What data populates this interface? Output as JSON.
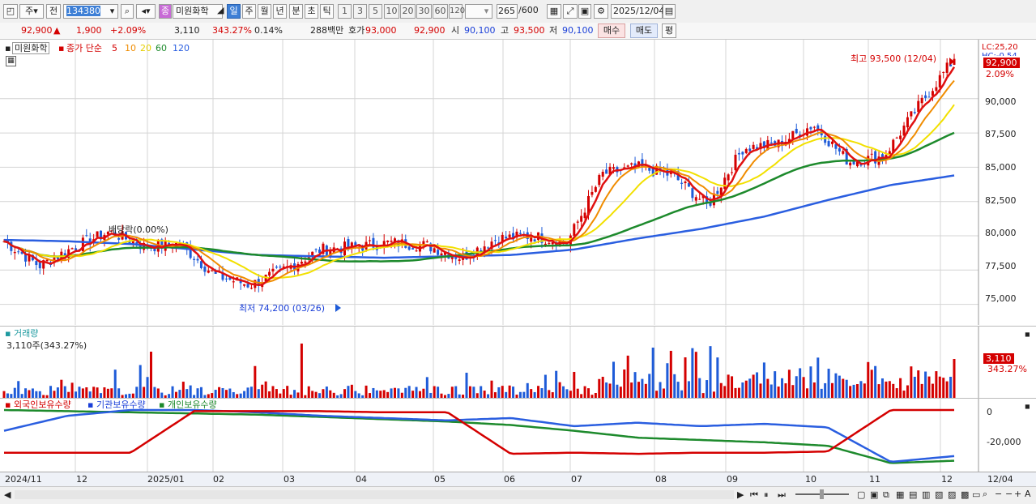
{
  "toolbar": {
    "type_select": "주",
    "prev_label": "전",
    "code": "134380",
    "name": "미원화학",
    "periods": [
      "일",
      "주",
      "월",
      "년",
      "분",
      "초",
      "틱"
    ],
    "active_period": "일",
    "numbers": [
      "1",
      "3",
      "5",
      "10",
      "20",
      "30",
      "60",
      "120"
    ],
    "count": "265",
    "count_total": "/600",
    "date": "2025/12/04"
  },
  "info": {
    "price": "92,900",
    "change": "1,900",
    "rate": "+2.09%",
    "volume": "3,110",
    "vol_rate": "343.27%",
    "turnover": "0.14%",
    "amount": "288백만",
    "quote_label": "호가",
    "bid": "93,000",
    "ask": "92,900",
    "open_label": "시",
    "open": "90,100",
    "high_label": "고",
    "high": "93,500",
    "low_label": "저",
    "low": "90,100",
    "buy_label": "매수",
    "sell_label": "매도",
    "avg_label": "평"
  },
  "price_panel": {
    "stock_name": "미원화학",
    "ma_label": "종가 단순",
    "ma_periods": [
      "5",
      "10",
      "20",
      "60",
      "120"
    ],
    "dividend_label": "배당락(0.00%)",
    "high_marker": "최고 93,500 (12/04)",
    "low_marker": "최저 74,200 (03/26)",
    "lc": "LC:25,20",
    "hc": "HC:-0.54",
    "last_price": "92,900",
    "last_rate": "2.09%",
    "y_ticks": [
      "90,000",
      "87,500",
      "85,000",
      "82,500",
      "80,000",
      "77,500",
      "75,000"
    ]
  },
  "volume_panel": {
    "title": "거래량",
    "value": "3,110주(343.27%)",
    "last_value": "3,110",
    "last_rate": "343.27%"
  },
  "holding_panel": {
    "foreign_label": "외국인보유수량",
    "inst_label": "기관보유수량",
    "indiv_label": "개인보유수량",
    "y_ticks": [
      "0",
      "-20,000"
    ]
  },
  "x_labels": [
    "2024/11",
    "12",
    "2025/01",
    "02",
    "03",
    "04",
    "05",
    "06",
    "07",
    "08",
    "09",
    "10",
    "11",
    "12",
    "12/04"
  ],
  "colors": {
    "up": "#d40000",
    "down": "#1e5bd8",
    "ma5": "#e01010",
    "ma10": "#f08c00",
    "ma20": "#f2e000",
    "ma60": "#1d8a2c",
    "ma120": "#2a5ee0",
    "grid": "#d4d4d4"
  },
  "chart_data": {
    "type": "candlestick",
    "y_range": [
      73500,
      94300
    ],
    "price_keypoints": [
      {
        "date": "2024/11",
        "close": 79600
      },
      {
        "date": "2024/11 mid",
        "close": 77800
      },
      {
        "date": "2024/12",
        "close": 79200
      },
      {
        "date": "2024/12 mid",
        "close": 80300
      },
      {
        "date": "2025/01",
        "close": 79200
      },
      {
        "date": "2025/01 mid",
        "close": 79400
      },
      {
        "date": "2025/02",
        "close": 77100
      },
      {
        "date": "2025/02 mid",
        "close": 76400
      },
      {
        "date": "2025/03",
        "close": 77600
      },
      {
        "date": "2025/03/26",
        "close": 79000,
        "low": 74200
      },
      {
        "date": "2025/04",
        "close": 79200
      },
      {
        "date": "2025/04 mid",
        "close": 79500
      },
      {
        "date": "2025/05",
        "close": 79300
      },
      {
        "date": "2025/05 mid",
        "close": 78400
      },
      {
        "date": "2025/06",
        "close": 79800
      },
      {
        "date": "2025/06 mid",
        "close": 80000
      },
      {
        "date": "2025/07",
        "close": 79500
      },
      {
        "date": "2025/07 mid",
        "close": 84500
      },
      {
        "date": "2025/08",
        "close": 85000
      },
      {
        "date": "2025/08 mid",
        "close": 84400
      },
      {
        "date": "2025/09",
        "close": 82200
      },
      {
        "date": "2025/09 mid",
        "close": 86400
      },
      {
        "date": "2025/10",
        "close": 86700
      },
      {
        "date": "2025/10 mid",
        "close": 88100
      },
      {
        "date": "2025/11",
        "close": 85400
      },
      {
        "date": "2025/11 mid",
        "close": 85800
      },
      {
        "date": "2025/12",
        "close": 89500
      },
      {
        "date": "2025/12/04",
        "close": 92900,
        "high": 93500
      }
    ],
    "ma120_keypoints": [
      79700,
      79600,
      79400,
      79000,
      78600,
      78500,
      78400,
      78500,
      78600,
      79000,
      79800,
      80500,
      81400,
      82600,
      83700,
      84400
    ],
    "holdings": {
      "foreign": [
        -18500,
        -18500,
        -18500,
        -500,
        -500,
        -500,
        -1000,
        -1000,
        -19000,
        -18500,
        -19000,
        -18500,
        -18500,
        -18000,
        0,
        0
      ],
      "institution": [
        -9000,
        -2500,
        0,
        0,
        -1000,
        -2500,
        -3500,
        -4500,
        -3500,
        -7000,
        -5500,
        -7000,
        -6000,
        -7500,
        -22500,
        -20000
      ],
      "individual": [
        0,
        -500,
        -1000,
        -1500,
        -2000,
        -3000,
        -4000,
        -5000,
        -6500,
        -9000,
        -12000,
        -13000,
        -14000,
        -15500,
        -23000,
        -22000
      ]
    }
  }
}
